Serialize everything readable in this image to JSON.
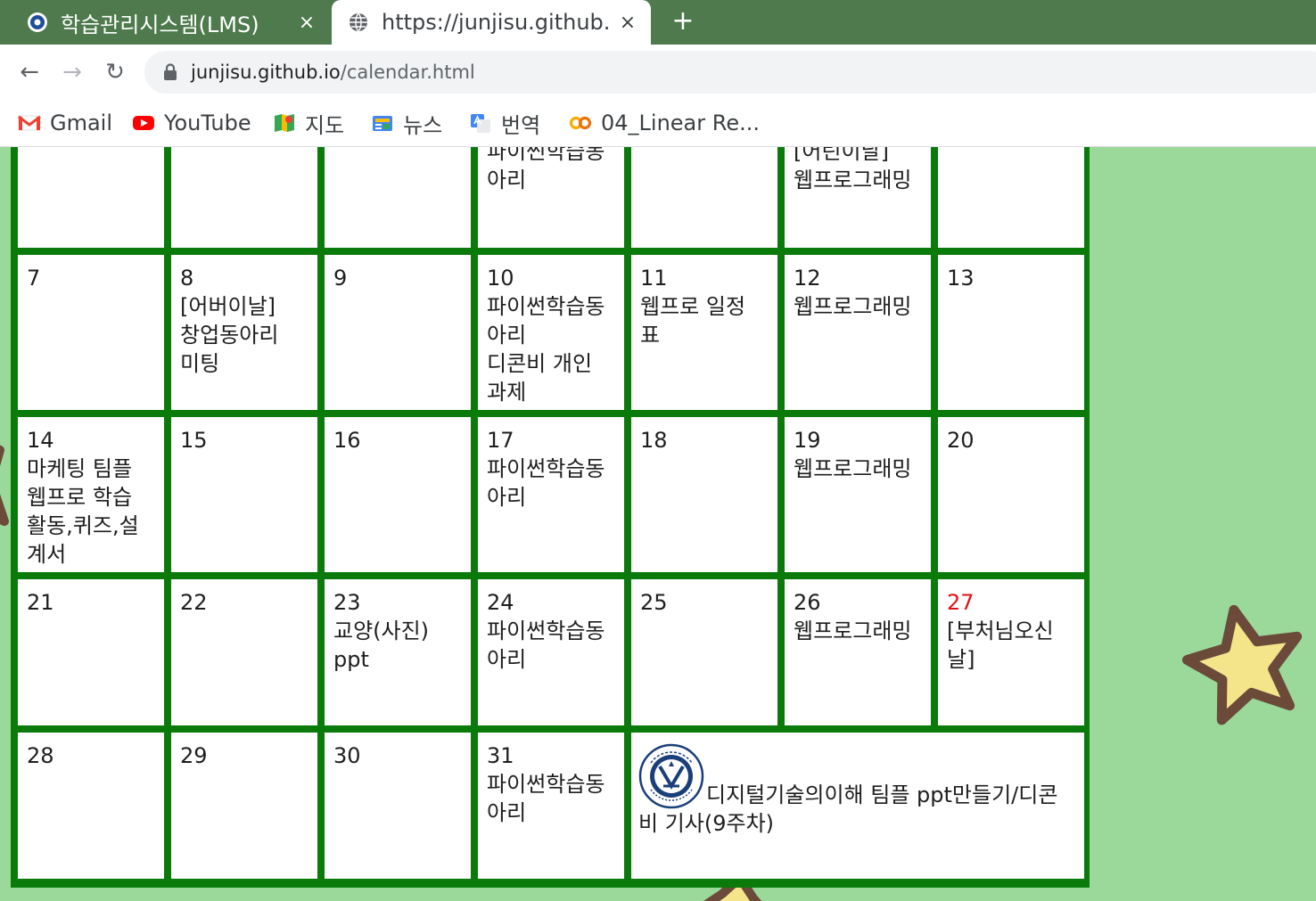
{
  "tabs": [
    {
      "title": "학습관리시스템(LMS)",
      "close": "×",
      "active": false
    },
    {
      "title": "https://junjisu.github.io",
      "close": "×",
      "active": true
    }
  ],
  "new_tab": "+",
  "nav": {
    "back": "←",
    "forward": "→",
    "reload": "↻"
  },
  "address": {
    "host": "junjisu.github.io",
    "path": "/calendar.html"
  },
  "bookmarks": [
    {
      "label": "Gmail",
      "icon": "gmail-icon"
    },
    {
      "label": "YouTube",
      "icon": "youtube-icon"
    },
    {
      "label": "지도",
      "icon": "maps-icon"
    },
    {
      "label": "뉴스",
      "icon": "news-icon"
    },
    {
      "label": "번역",
      "icon": "translate-icon"
    },
    {
      "label": "04_Linear Re...",
      "icon": "colab-icon"
    }
  ],
  "calendar": {
    "partial_row": [
      {
        "day": "",
        "text": ""
      },
      {
        "day": "",
        "text": ""
      },
      {
        "day": "",
        "text": ""
      },
      {
        "day": "",
        "text": "파이썬학습동\n아리"
      },
      {
        "day": "",
        "text": ""
      },
      {
        "day": "",
        "text": "[어린이날]\n웹프로그래밍"
      },
      {
        "day": "",
        "text": ""
      }
    ],
    "weeks": [
      [
        {
          "day": "7",
          "text": ""
        },
        {
          "day": "8",
          "text": "[어버이날]\n창업동아리\n미팅"
        },
        {
          "day": "9",
          "text": ""
        },
        {
          "day": "10",
          "text": "파이썬학습동\n아리\n디콘비 개인\n과제"
        },
        {
          "day": "11",
          "text": "웹프로 일정\n표"
        },
        {
          "day": "12",
          "text": "웹프로그래밍"
        },
        {
          "day": "13",
          "text": ""
        }
      ],
      [
        {
          "day": "14",
          "text": "마케팅 팀플\n웹프로 학습\n활동,퀴즈,설\n계서"
        },
        {
          "day": "15",
          "text": ""
        },
        {
          "day": "16",
          "text": ""
        },
        {
          "day": "17",
          "text": "파이썬학습동\n아리"
        },
        {
          "day": "18",
          "text": ""
        },
        {
          "day": "19",
          "text": "웹프로그래밍"
        },
        {
          "day": "20",
          "text": ""
        }
      ],
      [
        {
          "day": "21",
          "text": ""
        },
        {
          "day": "22",
          "text": ""
        },
        {
          "day": "23",
          "text": "교양(사진)\nppt"
        },
        {
          "day": "24",
          "text": "파이썬학습동\n아리"
        },
        {
          "day": "25",
          "text": ""
        },
        {
          "day": "26",
          "text": "웹프로그래밍"
        },
        {
          "day": "27",
          "text": "[부처님오신\n날]",
          "holiday": true
        }
      ],
      [
        {
          "day": "28",
          "text": ""
        },
        {
          "day": "29",
          "text": ""
        },
        {
          "day": "30",
          "text": ""
        },
        {
          "day": "31",
          "text": "파이썬학습동\n아리"
        }
      ]
    ],
    "note": {
      "text": "디지털기술의이해 팀플 ppt만들기/디콘비 기사(9주차)",
      "logo_label": "호서대학교 HOSEO UNIVERSITY",
      "logo_icon": "university-seal-icon"
    }
  },
  "colors": {
    "tabstrip": "#4e7a4e",
    "grid": "#0a7a0a",
    "page_background": "#9ad99a",
    "holiday": "#e0101a",
    "star_fill": "#f4e58a",
    "star_stroke": "#6b4a3a"
  }
}
